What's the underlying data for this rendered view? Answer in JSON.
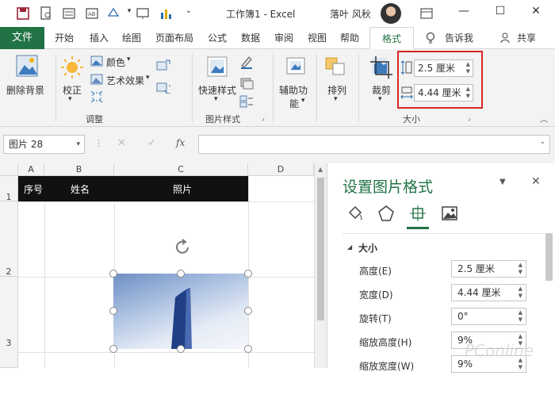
{
  "app": {
    "title": "工作簿1 - Excel",
    "user_name": "落叶 风秋"
  },
  "tabs": {
    "file": "文件",
    "items": [
      "开始",
      "插入",
      "绘图",
      "页面布局",
      "公式",
      "数据",
      "审阅",
      "视图",
      "帮助"
    ],
    "active": "格式",
    "tell_me": "告诉我",
    "share": "共享"
  },
  "ribbon": {
    "remove_bg": "删除背景",
    "corrections": "校正",
    "color": "颜色",
    "artistic": "艺术效果",
    "adjust_group": "调整",
    "quick_styles": "快速样式",
    "styles_group": "图片样式",
    "alt_text_1": "辅助功",
    "alt_text_2": "能",
    "arrange": "排列",
    "crop": "裁剪",
    "height_value": "2.5 厘米",
    "width_value": "4.44 厘米",
    "size_group": "大小"
  },
  "formula_bar": {
    "name_box": "图片 28",
    "fx": "fx"
  },
  "grid": {
    "columns": [
      "A",
      "B",
      "C",
      "D"
    ],
    "rows": [
      "1",
      "2",
      "3"
    ],
    "header_cells": [
      "序号",
      "姓名",
      "照片"
    ]
  },
  "pane": {
    "title": "设置图片格式",
    "section": "大小",
    "rows": [
      {
        "label": "高度(E)",
        "value": "2.5 厘米"
      },
      {
        "label": "宽度(D)",
        "value": "4.44 厘米"
      },
      {
        "label": "旋转(T)",
        "value": "0°"
      },
      {
        "label": "缩放高度(H)",
        "value": "9%"
      },
      {
        "label": "缩放宽度(W)",
        "value": "9%"
      }
    ]
  },
  "watermark": "PConline",
  "colors": {
    "excel_green": "#217346",
    "highlight_red": "#d62626"
  }
}
